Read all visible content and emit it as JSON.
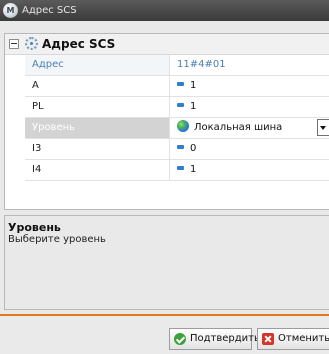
{
  "window": {
    "title": "Адрес SCS",
    "app_icon_text": "M"
  },
  "group": {
    "title": "Адрес SCS"
  },
  "rows": [
    {
      "label": "Адрес",
      "value": "11#4#01",
      "state": "disabled",
      "icon": ""
    },
    {
      "label": "A",
      "value": "1",
      "state": "normal",
      "icon": "number-icon"
    },
    {
      "label": "PL",
      "value": "1",
      "state": "normal",
      "icon": "number-icon"
    },
    {
      "label": "Уровень",
      "value": "Локальная шина",
      "state": "selected",
      "icon": "globe-icon"
    },
    {
      "label": "I3",
      "value": "0",
      "state": "normal",
      "icon": "number-icon"
    },
    {
      "label": "I4",
      "value": "1",
      "state": "normal",
      "icon": "number-icon"
    }
  ],
  "description": {
    "title": "Уровень",
    "text": "Выберите уровень"
  },
  "buttons": {
    "confirm": "Подтвердить",
    "cancel": "Отменить"
  },
  "colors": {
    "accent": "#e07b1d",
    "titlebar": "#3a3a3a",
    "link_blue": "#4a7fb0"
  }
}
